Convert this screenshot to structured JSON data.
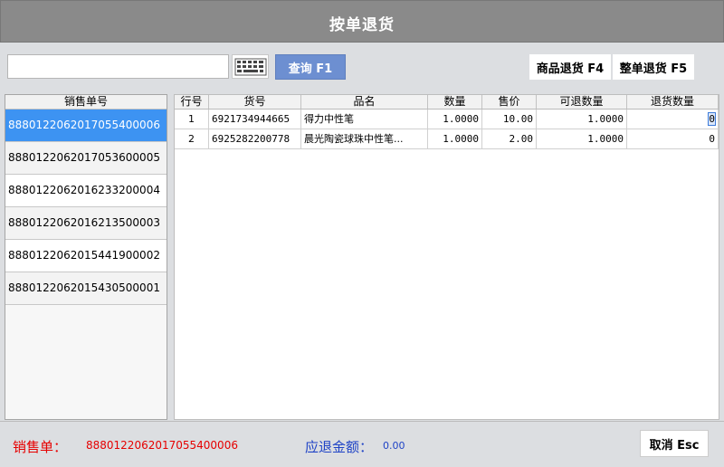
{
  "window": {
    "title": "按单退货"
  },
  "search": {
    "value": "",
    "placeholder": ""
  },
  "toolbar": {
    "keyboard_icon": "keyboard-icon",
    "query_label": "查询 F1",
    "item_return_label": "商品退货 F4",
    "order_return_label": "整单退货 F5"
  },
  "orders": {
    "header": "销售单号",
    "items": [
      "8880122062017055400006",
      "8880122062017053600005",
      "8880122062016233200004",
      "8880122062016213500003",
      "8880122062015441900002",
      "8880122062015430500001"
    ]
  },
  "grid": {
    "columns": [
      "行号",
      "货号",
      "品名",
      "数量",
      "售价",
      "可退数量",
      "退货数量"
    ],
    "rows": [
      [
        "1",
        "6921734944665",
        "得力中性笔",
        "1.0000",
        "10.00",
        "1.0000",
        "0"
      ],
      [
        "2",
        "6925282200778",
        "晨光陶瓷球珠中性笔...",
        "1.0000",
        "2.00",
        "1.0000",
        "0"
      ]
    ]
  },
  "footer": {
    "order_label": "销售单：",
    "order_value": "8880122062017055400006",
    "amount_label": "应退金额：",
    "amount_value": "0.00",
    "cancel_label": "取消 Esc"
  },
  "colors": {
    "titlebar": "#8a8a8a",
    "query_button": "#6d8fd1",
    "selected_row": "#3d93f2",
    "order_text": "#e60000",
    "amount_text": "#1f43c6"
  }
}
